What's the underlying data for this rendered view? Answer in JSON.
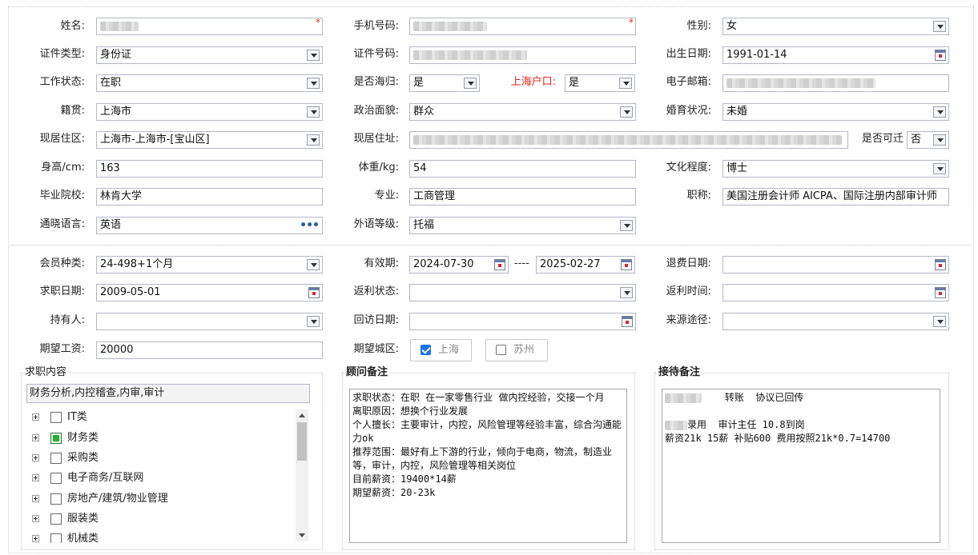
{
  "labels": {
    "name": "姓名:",
    "mobile": "手机号码:",
    "gender": "性别:",
    "id_type": "证件类型:",
    "id_no": "证件号码:",
    "birth": "出生日期:",
    "work_status": "工作状态:",
    "returnee": "是否海归:",
    "sh_hukou": "上海户口:",
    "email": "电子邮箱:",
    "native": "籍贯:",
    "political": "政治面貌:",
    "marital": "婚育状况:",
    "residence_area": "现居住区:",
    "residence_addr": "现居住址:",
    "relocate": "是否可迁",
    "height": "身高/cm:",
    "weight": "体重/kg:",
    "education": "文化程度:",
    "school": "毕业院校:",
    "major": "专业:",
    "title": "职称:",
    "language": "通晓语言:",
    "lang_level": "外语等级:",
    "member_type": "会员种类:",
    "validity": "有效期:",
    "refund_date": "退费日期:",
    "job_date": "求职日期:",
    "rebate_status": "返利状态:",
    "rebate_time": "返利时间:",
    "holder": "持有人:",
    "revisit_date": "回访日期:",
    "source": "来源途径:",
    "expected_salary": "期望工资:",
    "expected_city": "期望城区:",
    "validity_sep": "----"
  },
  "values": {
    "gender": "女",
    "id_type": "身份证",
    "birth": "1991-01-14",
    "work_status": "在职",
    "returnee": "是",
    "sh_hukou": "是",
    "native": "上海市",
    "political": "群众",
    "marital": "未婚",
    "residence_area": "上海市-上海市-[宝山区]",
    "relocate": "否",
    "height": "163",
    "weight": "54",
    "education": "博士",
    "school": "林肯大学",
    "major": "工商管理",
    "title": "美国注册会计师 AICPA、国际注册内部审计师",
    "language": "英语",
    "lang_level": "托福",
    "member_type": "24-498+1个月",
    "validity_from": "2024-07-30",
    "validity_to": "2025-02-27",
    "refund_date": "",
    "job_date": "2009-05-01",
    "rebate_status": "",
    "rebate_time": "",
    "holder": "",
    "revisit_date": "",
    "source": "",
    "expected_salary": "20000"
  },
  "cities": [
    {
      "label": "上海",
      "checked": true
    },
    {
      "label": "苏州",
      "checked": false
    }
  ],
  "job_content": {
    "legend": "求职内容",
    "summary": "财务分析,内控稽查,内审,审计",
    "categories": [
      {
        "label": "IT类",
        "checked": false
      },
      {
        "label": "财务类",
        "checked": true
      },
      {
        "label": "采购类",
        "checked": false
      },
      {
        "label": "电子商务/互联网",
        "checked": false
      },
      {
        "label": "房地产/建筑/物业管理",
        "checked": false
      },
      {
        "label": "服装类",
        "checked": false
      },
      {
        "label": "机械类",
        "checked": false
      }
    ]
  },
  "advisor_notes": {
    "legend": "顾问备注",
    "text": "求职状态：在职 在一家零售行业 做内控经验，交接一个月\n离职原因：想换个行业发展\n个人擅长：主要审计，内控，风险管理等经验丰富，综合沟通能力ok\n推荐范围：最好有上下游的行业，倾向于电商，物流，制造业等，审计，内控，风险管理等相关岗位\n目前薪资：19400*14薪\n期望薪资：20-23k"
  },
  "reception_notes": {
    "legend": "接待备注",
    "line1": "转账  协议已回传",
    "line2": "录用  审计主任 10.8到岗",
    "line3": "薪资21k 15薪 补贴600 费用按照21k*0.7=14700"
  },
  "required_mark": "*"
}
